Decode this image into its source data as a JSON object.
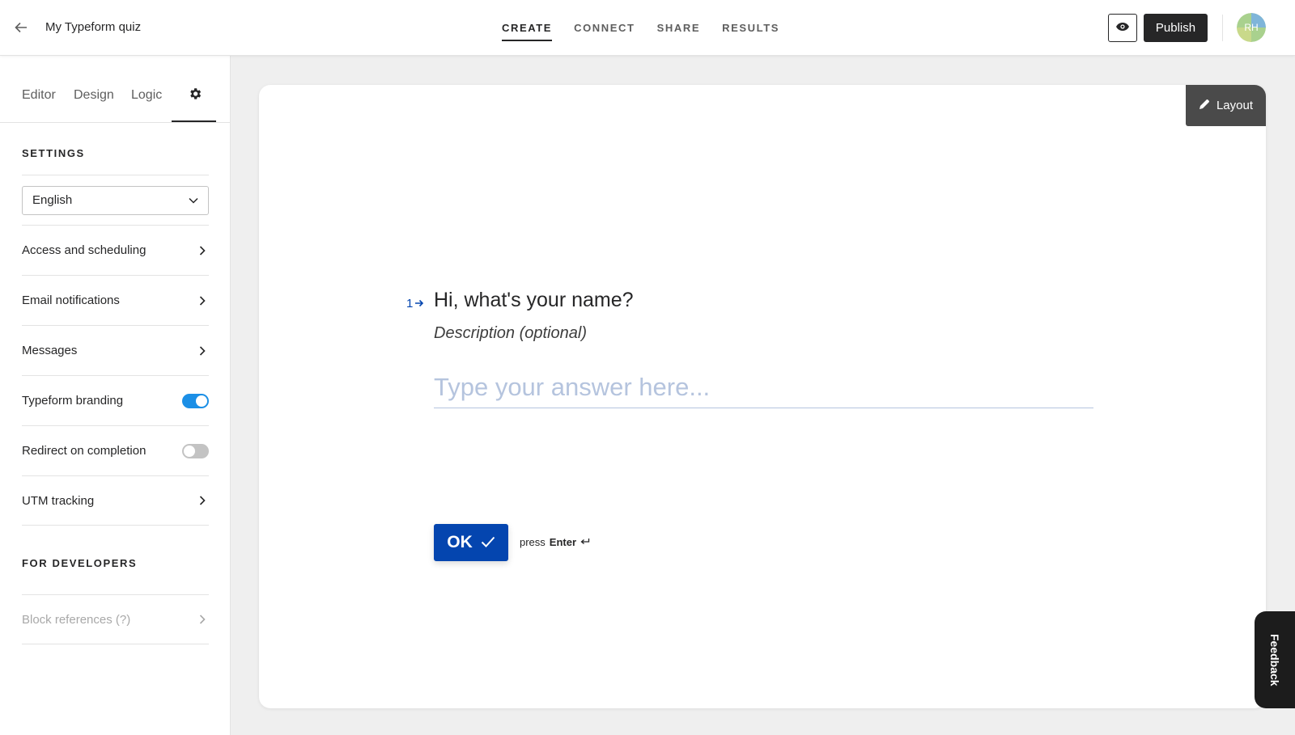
{
  "header": {
    "title": "My Typeform quiz",
    "tabs": [
      {
        "label": "CREATE",
        "active": true
      },
      {
        "label": "CONNECT",
        "active": false
      },
      {
        "label": "SHARE",
        "active": false
      },
      {
        "label": "RESULTS",
        "active": false
      }
    ],
    "publish_label": "Publish",
    "avatar_initials": "RH"
  },
  "sidebar": {
    "tabs": [
      {
        "label": "Editor"
      },
      {
        "label": "Design"
      },
      {
        "label": "Logic"
      }
    ],
    "active_tab_icon": "gear-icon",
    "settings_heading": "SETTINGS",
    "language": "English",
    "items": [
      {
        "label": "Access and scheduling",
        "control": "chevron"
      },
      {
        "label": "Email notifications",
        "control": "chevron"
      },
      {
        "label": "Messages",
        "control": "chevron"
      },
      {
        "label": "Typeform branding",
        "control": "toggle",
        "on": true
      },
      {
        "label": "Redirect on completion",
        "control": "toggle",
        "on": false
      },
      {
        "label": "UTM tracking",
        "control": "chevron"
      }
    ],
    "developers_heading": "FOR DEVELOPERS",
    "developer_items": [
      {
        "label": "Block references (?)",
        "disabled": true
      }
    ]
  },
  "canvas": {
    "layout_label": "Layout",
    "question_number": "1",
    "question_title": "Hi, what's your name?",
    "description": "Description (optional)",
    "answer_placeholder": "Type your answer here...",
    "ok_label": "OK",
    "press_prefix": "press",
    "press_key": "Enter"
  },
  "feedback_label": "Feedback",
  "colors": {
    "accent_blue": "#0445af",
    "toggle_on": "#1b8fe6",
    "publish_bg": "#262627"
  }
}
